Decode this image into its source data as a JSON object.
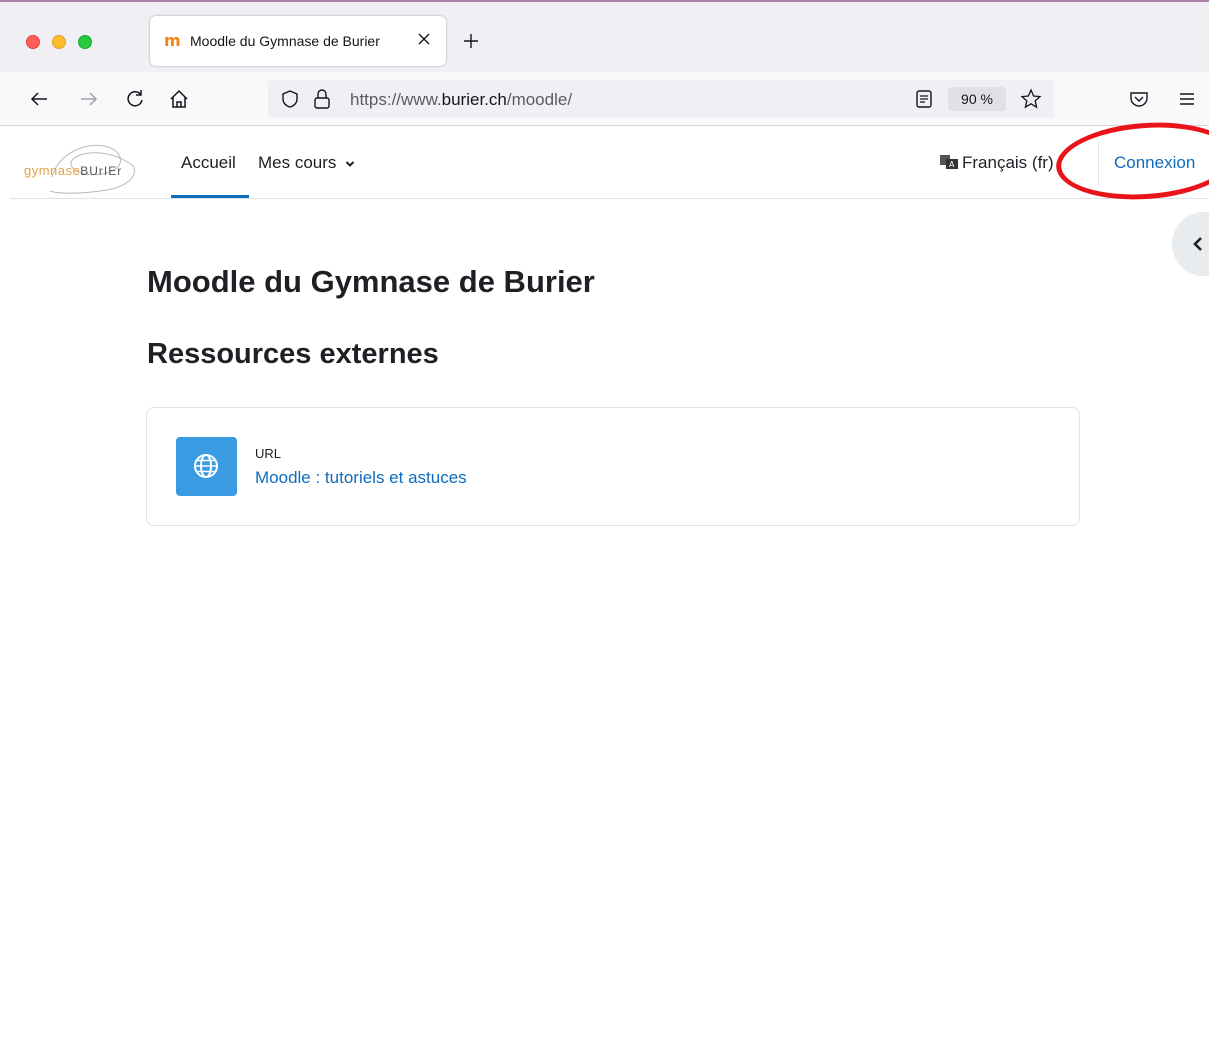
{
  "browser": {
    "tab_title": "Moodle du Gymnase de Burier",
    "tab_favicon": "m",
    "url_prefix": "https://www.",
    "url_domain": "burier.ch",
    "url_path": "/moodle/",
    "zoom": "90 %"
  },
  "header": {
    "logo_left": "gymnase",
    "logo_right": "BUrIEr",
    "nav": {
      "home": "Accueil",
      "my_courses": "Mes cours"
    },
    "language": "Français (fr)",
    "login": "Connexion"
  },
  "main": {
    "page_title": "Moodle du Gymnase de Burier",
    "section_title": "Ressources externes",
    "activity": {
      "type": "URL",
      "name": "Moodle : tutoriels et astuces"
    }
  },
  "colors": {
    "link": "#0f6cbf",
    "activity_icon": "#399be2",
    "annotation": "#e8141a",
    "moodle_orange": "#f98012"
  },
  "icons": {
    "back": "arrow-left-icon",
    "forward": "arrow-right-icon",
    "reload": "reload-icon",
    "home": "home-icon",
    "shield": "shield-icon",
    "lock": "lock-icon",
    "reader": "reader-view-icon",
    "bookmark": "star-icon",
    "pocket": "pocket-icon",
    "menu": "hamburger-menu-icon",
    "activity": "globe-icon"
  }
}
